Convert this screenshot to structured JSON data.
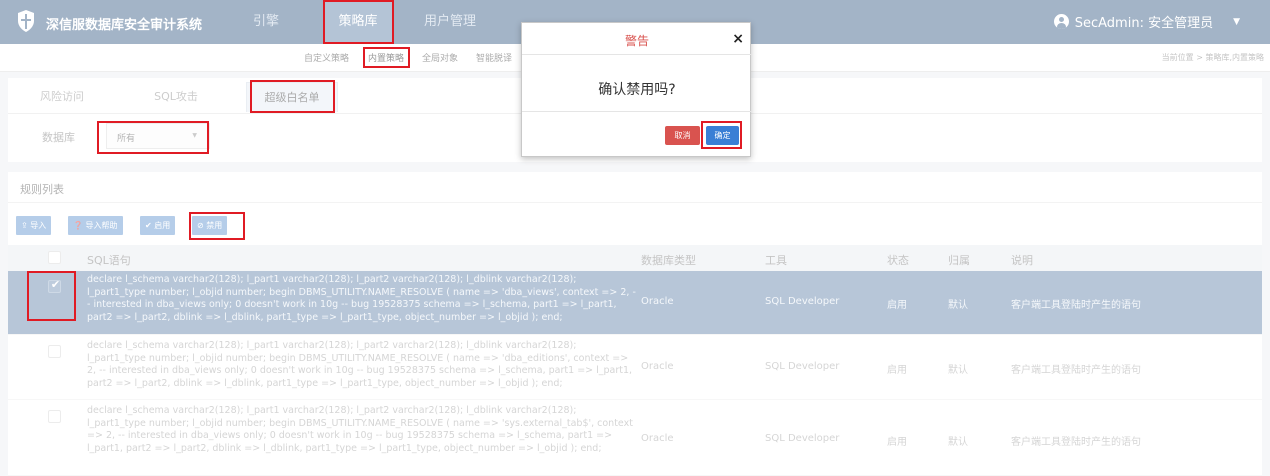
{
  "header": {
    "app_title": "深信服数据库安全审计系统",
    "nav": [
      "引擎",
      "策略库",
      "用户管理"
    ],
    "user": "SecAdmin: 安全管理员"
  },
  "subnav": {
    "items": [
      "自定义策略",
      "内置策略",
      "全局对象",
      "智能脱译"
    ],
    "breadcrumb": "当前位置 > 策略库,内置策略"
  },
  "tabs": [
    "风险访问",
    "SQL攻击",
    "超级白名单"
  ],
  "filter": {
    "label": "数据库",
    "value": "所有"
  },
  "list": {
    "title": "规则列表",
    "buttons": [
      "导入",
      "导入帮助",
      "启用",
      "禁用"
    ],
    "columns": [
      "SQL语句",
      "数据库类型",
      "工具",
      "状态",
      "归属",
      "说明"
    ],
    "rows": [
      {
        "sql": "declare l_schema varchar2(128); l_part1 varchar2(128); l_part2 varchar2(128); l_dblink varchar2(128); l_part1_type number; l_objid number; begin DBMS_UTILITY.NAME_RESOLVE ( name => 'dba_views', context => 2, -- interested in dba_views only; 0 doesn't work in 10g -- bug 19528375 schema => l_schema, part1 => l_part1, part2 => l_part2, dblink => l_dblink, part1_type => l_part1_type, object_number => l_objid ); end;",
        "db_type": "Oracle",
        "tool": "SQL Developer",
        "status": "启用",
        "owner": "默认",
        "desc": "客户端工具登陆时产生的语句"
      },
      {
        "sql": "declare l_schema varchar2(128); l_part1 varchar2(128); l_part2 varchar2(128); l_dblink varchar2(128); l_part1_type number; l_objid number; begin DBMS_UTILITY.NAME_RESOLVE ( name => 'dba_editions', context => 2, -- interested in dba_views only; 0 doesn't work in 10g -- bug 19528375 schema => l_schema, part1 => l_part1, part2 => l_part2, dblink => l_dblink, part1_type => l_part1_type, object_number => l_objid ); end;",
        "db_type": "Oracle",
        "tool": "SQL Developer",
        "status": "启用",
        "owner": "默认",
        "desc": "客户端工具登陆时产生的语句"
      },
      {
        "sql": "declare l_schema varchar2(128); l_part1 varchar2(128); l_part2 varchar2(128); l_dblink varchar2(128); l_part1_type number; l_objid number; begin DBMS_UTILITY.NAME_RESOLVE ( name => 'sys.external_tab$', context => 2, -- interested in dba_views only; 0 doesn't work in 10g -- bug 19528375 schema => l_schema, part1 => l_part1, part2 => l_part2, dblink => l_dblink, part1_type => l_part1_type, object_number => l_objid ); end;",
        "db_type": "Oracle",
        "tool": "SQL Developer",
        "status": "启用",
        "owner": "默认",
        "desc": "客户端工具登陆时产生的语句"
      }
    ]
  },
  "modal": {
    "title": "警告",
    "close": "×",
    "message": "确认禁用吗?",
    "cancel": "取消",
    "confirm": "确定"
  },
  "icons": {
    "logo": "shield-icon",
    "user": "user-circle-icon",
    "import": "upload-icon",
    "help": "question-icon",
    "enable": "check-icon",
    "disable": "ban-icon"
  },
  "colors": {
    "header": "#46688f",
    "active_nav": "#6888ad",
    "button": "#6a9bd3",
    "selected_row": "#6f8db0",
    "danger": "#d9534f",
    "primary": "#3a7fd5",
    "highlight": "#e01b24"
  }
}
